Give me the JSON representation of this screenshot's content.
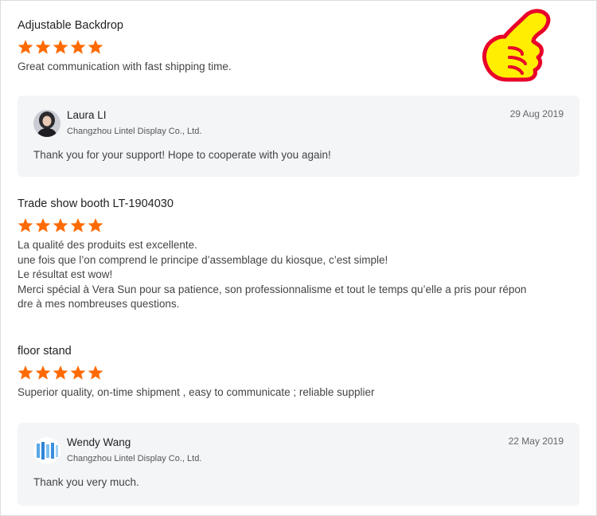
{
  "reviews": [
    {
      "title": "Adjustable Backdrop",
      "rating": 5,
      "comment": [
        "Great communication with fast shipping time."
      ],
      "reply": {
        "name": "Laura LI",
        "company": "Changzhou Lintel Display Co., Ltd.",
        "date": "29 Aug 2019",
        "text": "Thank you for your support! Hope to cooperate with you again!"
      }
    },
    {
      "title": "Trade show booth LT-1904030",
      "rating": 5,
      "comment": [
        "La qualité des produits est excellente.",
        "une fois que l’on comprend le principe d’assemblage du kiosque, c’est simple!",
        "Le résultat est wow!",
        "Merci spécial à Vera Sun pour sa patience, son professionnalisme et tout le temps qu’elle a pris pour répon",
        "dre à mes nombreuses questions."
      ]
    },
    {
      "title": "floor stand",
      "rating": 5,
      "comment": [
        "Superior quality, on-time shipment , easy to communicate ; reliable supplier"
      ],
      "reply": {
        "name": "Wendy Wang",
        "company": "Changzhou Lintel Display Co., Ltd.",
        "date": "22 May 2019",
        "text": "Thank you very much."
      }
    }
  ],
  "colors": {
    "star": "#ff6a00",
    "reply_bg": "#f4f5f7",
    "thumb_yellow": "#ffee00",
    "thumb_outline": "#e8002a"
  },
  "icons": {
    "star": "star-icon",
    "thumb": "thumbs-up-icon"
  }
}
